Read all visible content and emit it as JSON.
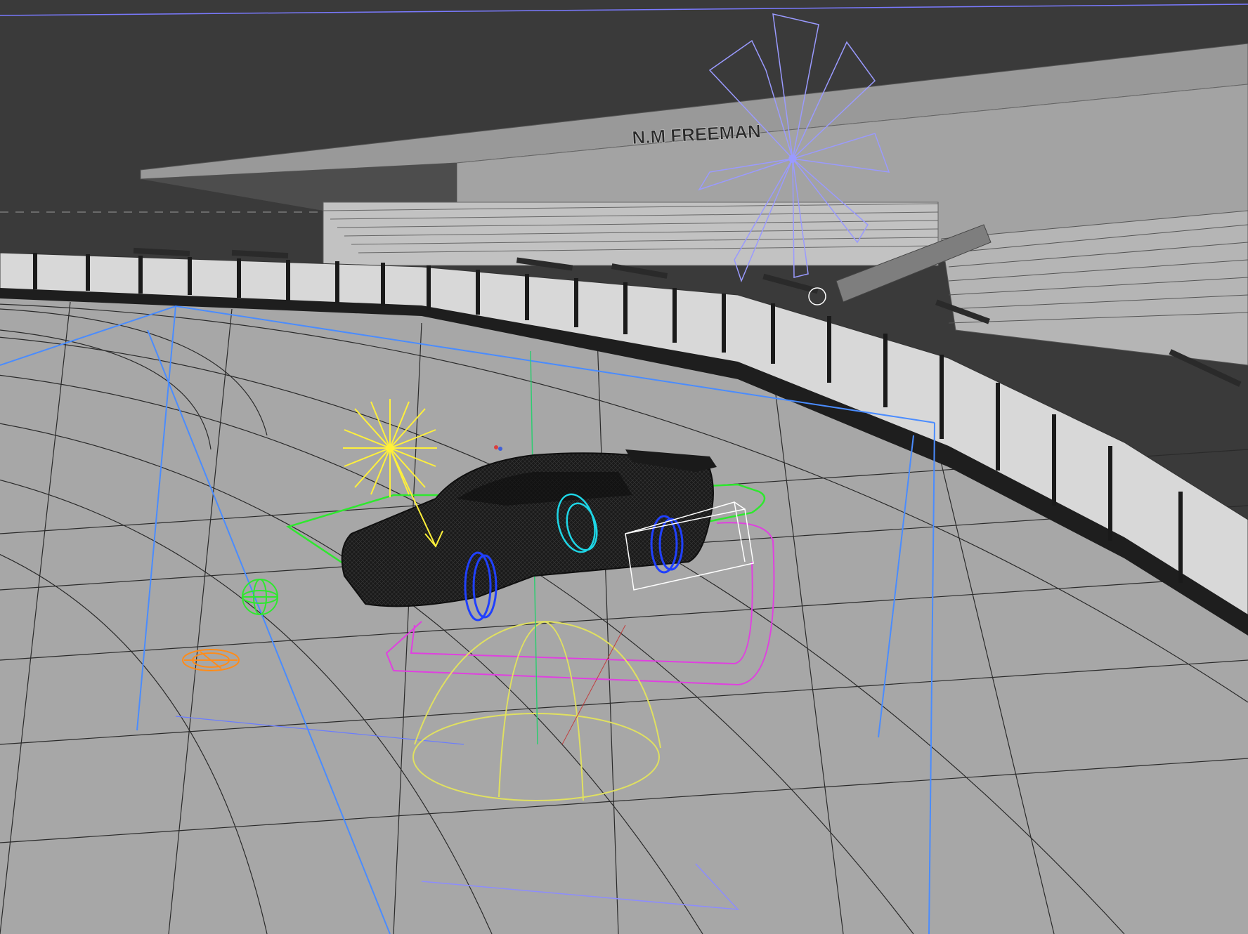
{
  "viewport": {
    "sign_text": "N.M FREEMAN",
    "colors": {
      "sky": "#3a3a3a",
      "ground": "#a7a7a7",
      "roof": "#999999",
      "stand": "#bdbdbd",
      "barrier_dark": "#1e1e1e",
      "car": "#1a1a1a",
      "light_helper": "#fff03a",
      "spot_helper": "#e0e060",
      "path_curve": "#e040e0",
      "sun_helper": "#9a9aff",
      "camera_helper": "#4a8cff",
      "selection_curve": "#2ee82e",
      "wheel_helper": "#2040ff",
      "cyan_helper": "#1ed6e6",
      "orange_helper": "#ff8c1a",
      "bbox": "#ffffff"
    }
  }
}
